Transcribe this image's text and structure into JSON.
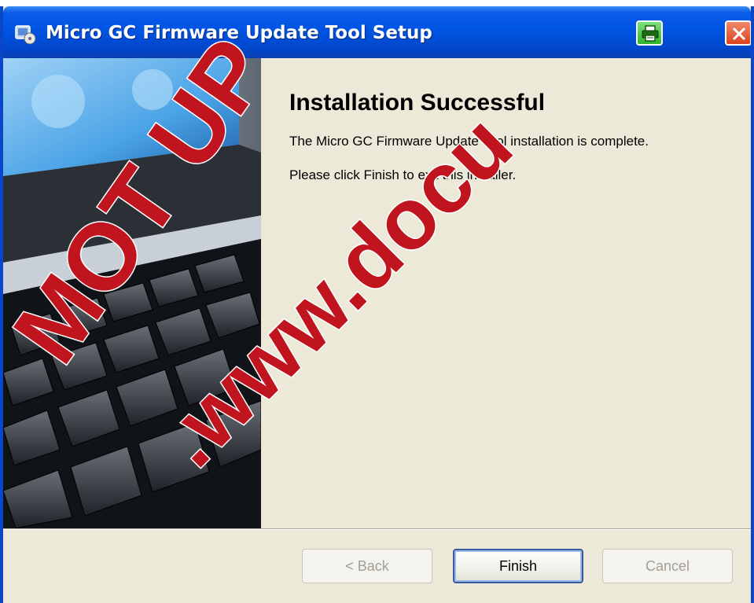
{
  "window": {
    "title": "Micro GC Firmware Update Tool Setup",
    "titlebar_color": "#0054e3"
  },
  "content": {
    "heading": "Installation Successful",
    "message": "The Micro GC Firmware Update Tool installation is complete.",
    "instruction": "Please click Finish to exit this installer."
  },
  "buttons": {
    "back": "< Back",
    "finish": "Finish",
    "cancel": "Cancel"
  },
  "icons": {
    "app": "installer-icon",
    "print": "printer-icon",
    "close": "close-icon"
  },
  "watermark": {
    "text_left": "MOT UP",
    "text_right": ".www.docu",
    "color": "#c0141e"
  }
}
